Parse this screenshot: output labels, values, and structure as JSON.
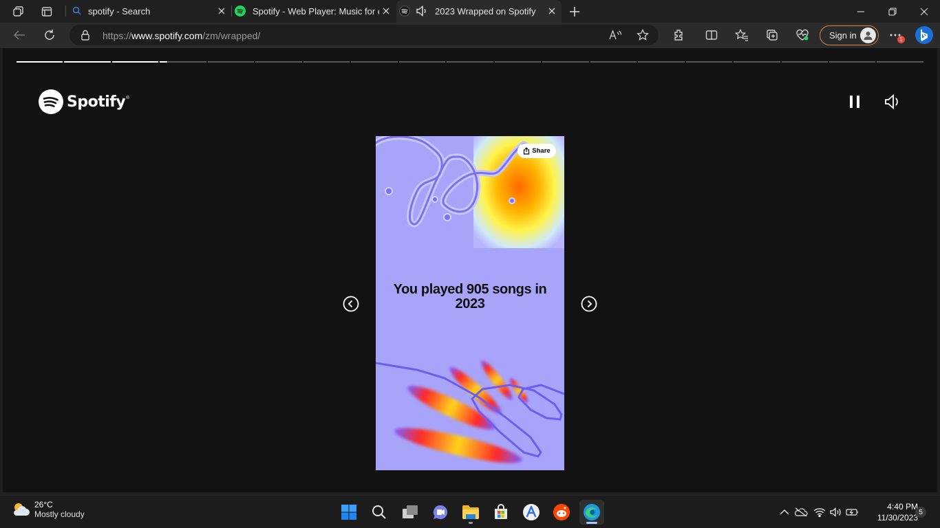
{
  "browser": {
    "tabs": [
      {
        "label": "spotify - Search",
        "icon": "search-icon"
      },
      {
        "label": "Spotify - Web Player: Music for eve",
        "icon": "spotify-icon"
      },
      {
        "label": "2023 Wrapped on Spotify",
        "icon": "speaker-icon",
        "active": true
      }
    ],
    "url_prefix": "https://",
    "url_host": "www.spotify.com",
    "url_path": "/zm/wrapped/",
    "signin_label": "Sign in",
    "notification_badge": "1"
  },
  "page": {
    "logo_text": "Spotify",
    "logo_tm": "®",
    "progress": {
      "total_segments": 19,
      "completed_segments": 3,
      "current_fraction": 0.15
    },
    "card": {
      "share_label": "Share",
      "headline": "You played 905 songs in 2023",
      "background_color": "#a8a4fa"
    }
  },
  "taskbar": {
    "weather_temp": "26°C",
    "weather_condition": "Mostly cloudy",
    "time": "4:40 PM",
    "date": "11/30/2023",
    "notification_count": "5"
  },
  "colors": {
    "accent_spotify": "#1ed760",
    "signin_border": "#d9823a",
    "page_bg": "#121212"
  }
}
